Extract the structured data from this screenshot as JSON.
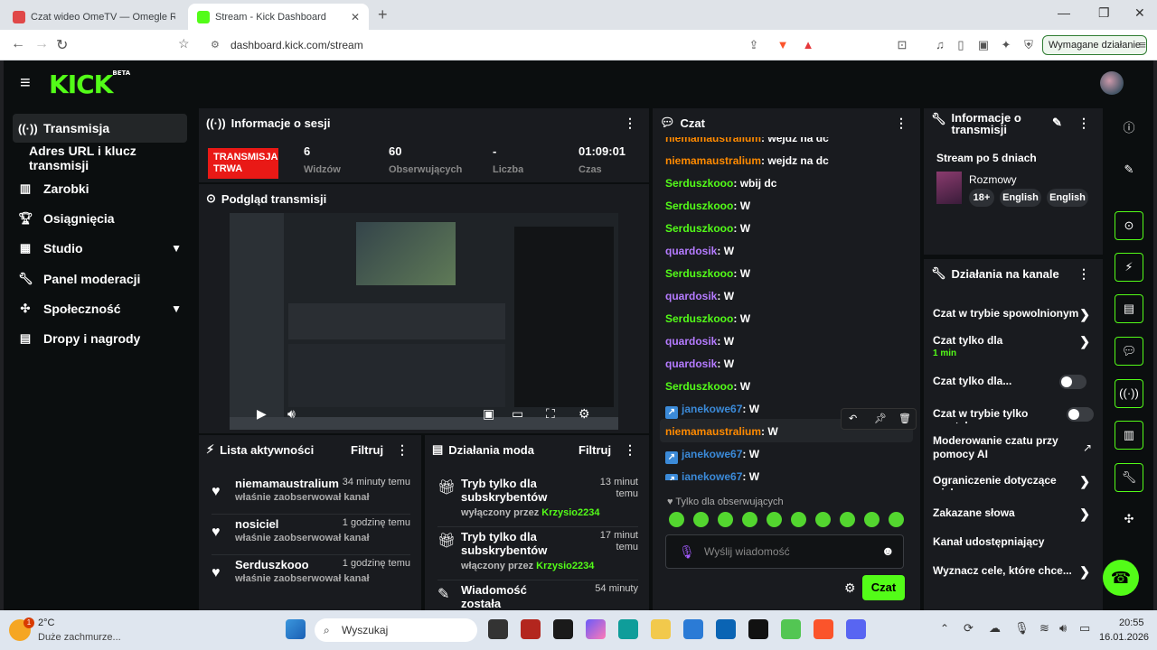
{
  "browser": {
    "tabs": [
      {
        "title": "Czat wideo OmeTV — Omegle R",
        "active": false
      },
      {
        "title": "Stream - Kick Dashboard",
        "active": true
      }
    ],
    "url": "dashboard.kick.com/stream",
    "action_required": "Wymagane działanie"
  },
  "app": {
    "logo": "KICK",
    "logo_beta": "BETA",
    "sidebar": [
      {
        "label": "Transmisja",
        "icon": "broadcast-icon",
        "selected": true
      },
      {
        "label": "Adres URL i klucz transmisji",
        "icon": "",
        "selected": false
      },
      {
        "label": "Zarobki",
        "icon": "chart-icon",
        "selected": false
      },
      {
        "label": "Osiągnięcia",
        "icon": "trophy-icon",
        "selected": false
      },
      {
        "label": "Studio",
        "icon": "studio-icon",
        "selected": false
      },
      {
        "label": "Panel moderacji",
        "icon": "wrench-icon",
        "selected": false
      },
      {
        "label": "Społeczność",
        "icon": "community-icon",
        "selected": false
      },
      {
        "label": "Dropy i nagrody",
        "icon": "gift-icon",
        "selected": false
      }
    ],
    "session": {
      "title": "Informacje o sesji",
      "live_badge": "TRANSMISJA TRWA",
      "stats": [
        "6",
        "60",
        "-",
        "01:09:01"
      ],
      "stat_labels": [
        "Widzów",
        "Obserwujących",
        "Liczba",
        "Czas"
      ]
    },
    "preview": {
      "title": "Podgląd transmisji"
    },
    "activity": {
      "title": "Lista aktywności",
      "filter": "Filtruj",
      "items": [
        {
          "name": "niemamaustralium",
          "time": "34 minuty temu",
          "desc": "właśnie zaobserwował kanał"
        },
        {
          "name": "nosiciel",
          "time": "1 godzinę temu",
          "desc": "właśnie zaobserwował kanał"
        },
        {
          "name": "Serduszkooo",
          "time": "1 godzinę temu",
          "desc": "właśnie zaobserwował kanał"
        }
      ]
    },
    "mod_actions": {
      "title": "Działania moda",
      "filter": "Filtruj",
      "items": [
        {
          "title": "Tryb tylko dla subskrybentów",
          "time": "13 minut temu",
          "state": "wyłączony przez",
          "by": "Krzysio2234"
        },
        {
          "title": "Tryb tylko dla subskrybentów",
          "time": "17 minut temu",
          "state": "włączony przez",
          "by": "Krzysio2234"
        },
        {
          "title": "Wiadomość została",
          "time": "54 minuty",
          "state": "",
          "by": ""
        }
      ]
    },
    "chat": {
      "title": "Czat",
      "messages": [
        {
          "user": "niemamaustralium",
          "color": "#ff8a00",
          "text": "wejdz na dc",
          "badge": false
        },
        {
          "user": "niemamaustralium",
          "color": "#ff8a00",
          "text": "wejdz na dc",
          "badge": false
        },
        {
          "user": "Serduszkooo",
          "color": "#53fc18",
          "text": "wbij dc",
          "badge": false
        },
        {
          "user": "Serduszkooo",
          "color": "#53fc18",
          "text": "W",
          "badge": false
        },
        {
          "user": "Serduszkooo",
          "color": "#53fc18",
          "text": "W",
          "badge": false
        },
        {
          "user": "quardosik",
          "color": "#b57bff",
          "text": "W",
          "badge": false
        },
        {
          "user": "Serduszkooo",
          "color": "#53fc18",
          "text": "W",
          "badge": false
        },
        {
          "user": "quardosik",
          "color": "#b57bff",
          "text": "W",
          "badge": false
        },
        {
          "user": "Serduszkooo",
          "color": "#53fc18",
          "text": "W",
          "badge": false
        },
        {
          "user": "quardosik",
          "color": "#b57bff",
          "text": "W",
          "badge": false
        },
        {
          "user": "quardosik",
          "color": "#b57bff",
          "text": "W",
          "badge": false
        },
        {
          "user": "Serduszkooo",
          "color": "#53fc18",
          "text": "W",
          "badge": false
        },
        {
          "user": "janekowe67",
          "color": "#3b8ad8",
          "text": "W",
          "badge": true
        },
        {
          "user": "niemamaustralium",
          "color": "#ff8a00",
          "text": "W",
          "badge": false
        },
        {
          "user": "janekowe67",
          "color": "#3b8ad8",
          "text": "W",
          "badge": true
        },
        {
          "user": "janekowe67",
          "color": "#3b8ad8",
          "text": "W",
          "badge": true
        }
      ],
      "followers_only": "Tylko dla obserwujących",
      "input_placeholder": "Wyślij wiadomość",
      "send_button": "Czat"
    },
    "stream_info": {
      "title": "Informacje o transmisji",
      "stream_title": "Stream po 5 dniach",
      "category": "Rozmowy",
      "tags": [
        "18+",
        "English",
        "English"
      ]
    },
    "channel_actions": {
      "title": "Działania na kanale",
      "items": [
        {
          "label": "Czat w trybie spowolnionym",
          "type": "arrow"
        },
        {
          "label": "Czat tylko dla obserwujących",
          "sub": "1 min",
          "type": "arrow"
        },
        {
          "label": "Czat tylko dla...",
          "type": "toggle"
        },
        {
          "label": "Czat w trybie tylko emotek",
          "type": "toggle"
        },
        {
          "label": "Moderowanie czatu przy pomocy AI",
          "type": "external"
        },
        {
          "label": "Ograniczenie dotyczące wiek",
          "type": "arrow"
        },
        {
          "label": "Zakazane słowa",
          "type": "arrow"
        },
        {
          "label": "Kanał udostępniający",
          "type": "none"
        },
        {
          "label": "Wyznacz cele, które chce...",
          "type": "arrow"
        }
      ]
    }
  },
  "taskbar": {
    "weather_temp": "2°C",
    "weather_desc": "Duże zachmurze...",
    "search": "Wyszukaj",
    "time": "20:55",
    "date": "16.01.2026"
  }
}
